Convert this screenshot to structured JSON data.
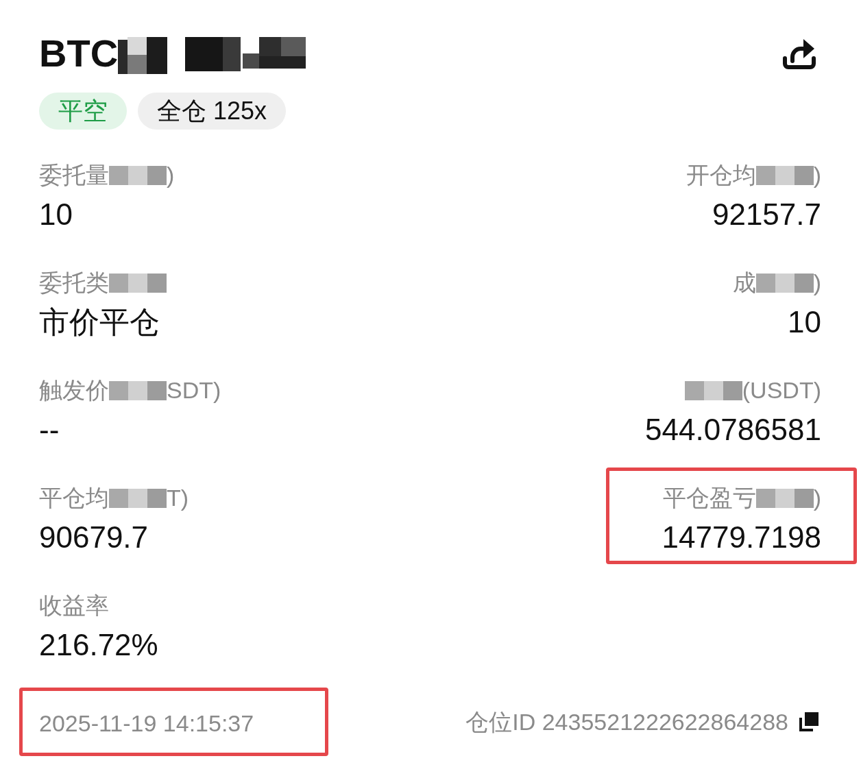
{
  "header": {
    "title_parts": [
      {
        "kind": "text",
        "text": "BTC"
      },
      {
        "kind": "redacted"
      }
    ],
    "tags": [
      {
        "kind": "side",
        "label": "平空"
      },
      {
        "kind": "margin",
        "label": "全仓 125x"
      }
    ]
  },
  "rows": [
    {
      "left": {
        "label_parts": [
          {
            "kind": "text",
            "text": "委托量"
          },
          {
            "kind": "redacted"
          },
          {
            "kind": "text",
            "text": ")"
          }
        ],
        "value": "10",
        "highlighted": false
      },
      "right": {
        "label_parts": [
          {
            "kind": "text",
            "text": "开仓均"
          },
          {
            "kind": "redacted"
          },
          {
            "kind": "text",
            "text": ")"
          }
        ],
        "value": "92157.7",
        "highlighted": false
      }
    },
    {
      "left": {
        "label_parts": [
          {
            "kind": "text",
            "text": "委托类"
          },
          {
            "kind": "redacted"
          }
        ],
        "value": "市价平仓",
        "highlighted": false
      },
      "right": {
        "label_parts": [
          {
            "kind": "text",
            "text": "成"
          },
          {
            "kind": "redacted"
          },
          {
            "kind": "text",
            "text": ")"
          }
        ],
        "value": "10",
        "highlighted": false
      }
    },
    {
      "left": {
        "label_parts": [
          {
            "kind": "text",
            "text": "触发价"
          },
          {
            "kind": "redacted"
          },
          {
            "kind": "text",
            "text": "SDT)"
          }
        ],
        "value": "--",
        "highlighted": false
      },
      "right": {
        "label_parts": [
          {
            "kind": "redacted"
          },
          {
            "kind": "text",
            "text": "(USDT)"
          }
        ],
        "value": "544.0786581",
        "highlighted": false
      }
    },
    {
      "left": {
        "label_parts": [
          {
            "kind": "text",
            "text": "平仓均"
          },
          {
            "kind": "redacted"
          },
          {
            "kind": "text",
            "text": "T)"
          }
        ],
        "value": "90679.7",
        "highlighted": false
      },
      "right": {
        "label_parts": [
          {
            "kind": "text",
            "text": "平仓盈亏"
          },
          {
            "kind": "redacted"
          },
          {
            "kind": "text",
            "text": ")"
          }
        ],
        "value": "14779.7198",
        "highlighted": true
      }
    },
    {
      "left": {
        "label_parts": [
          {
            "kind": "text",
            "text": "收益率"
          }
        ],
        "value": "216.72%",
        "highlighted": false
      }
    }
  ],
  "footer": {
    "time": {
      "text": "2025-11-19 14:15:37",
      "highlighted": true
    },
    "position_id": "仓位ID 2435521222622864288"
  }
}
